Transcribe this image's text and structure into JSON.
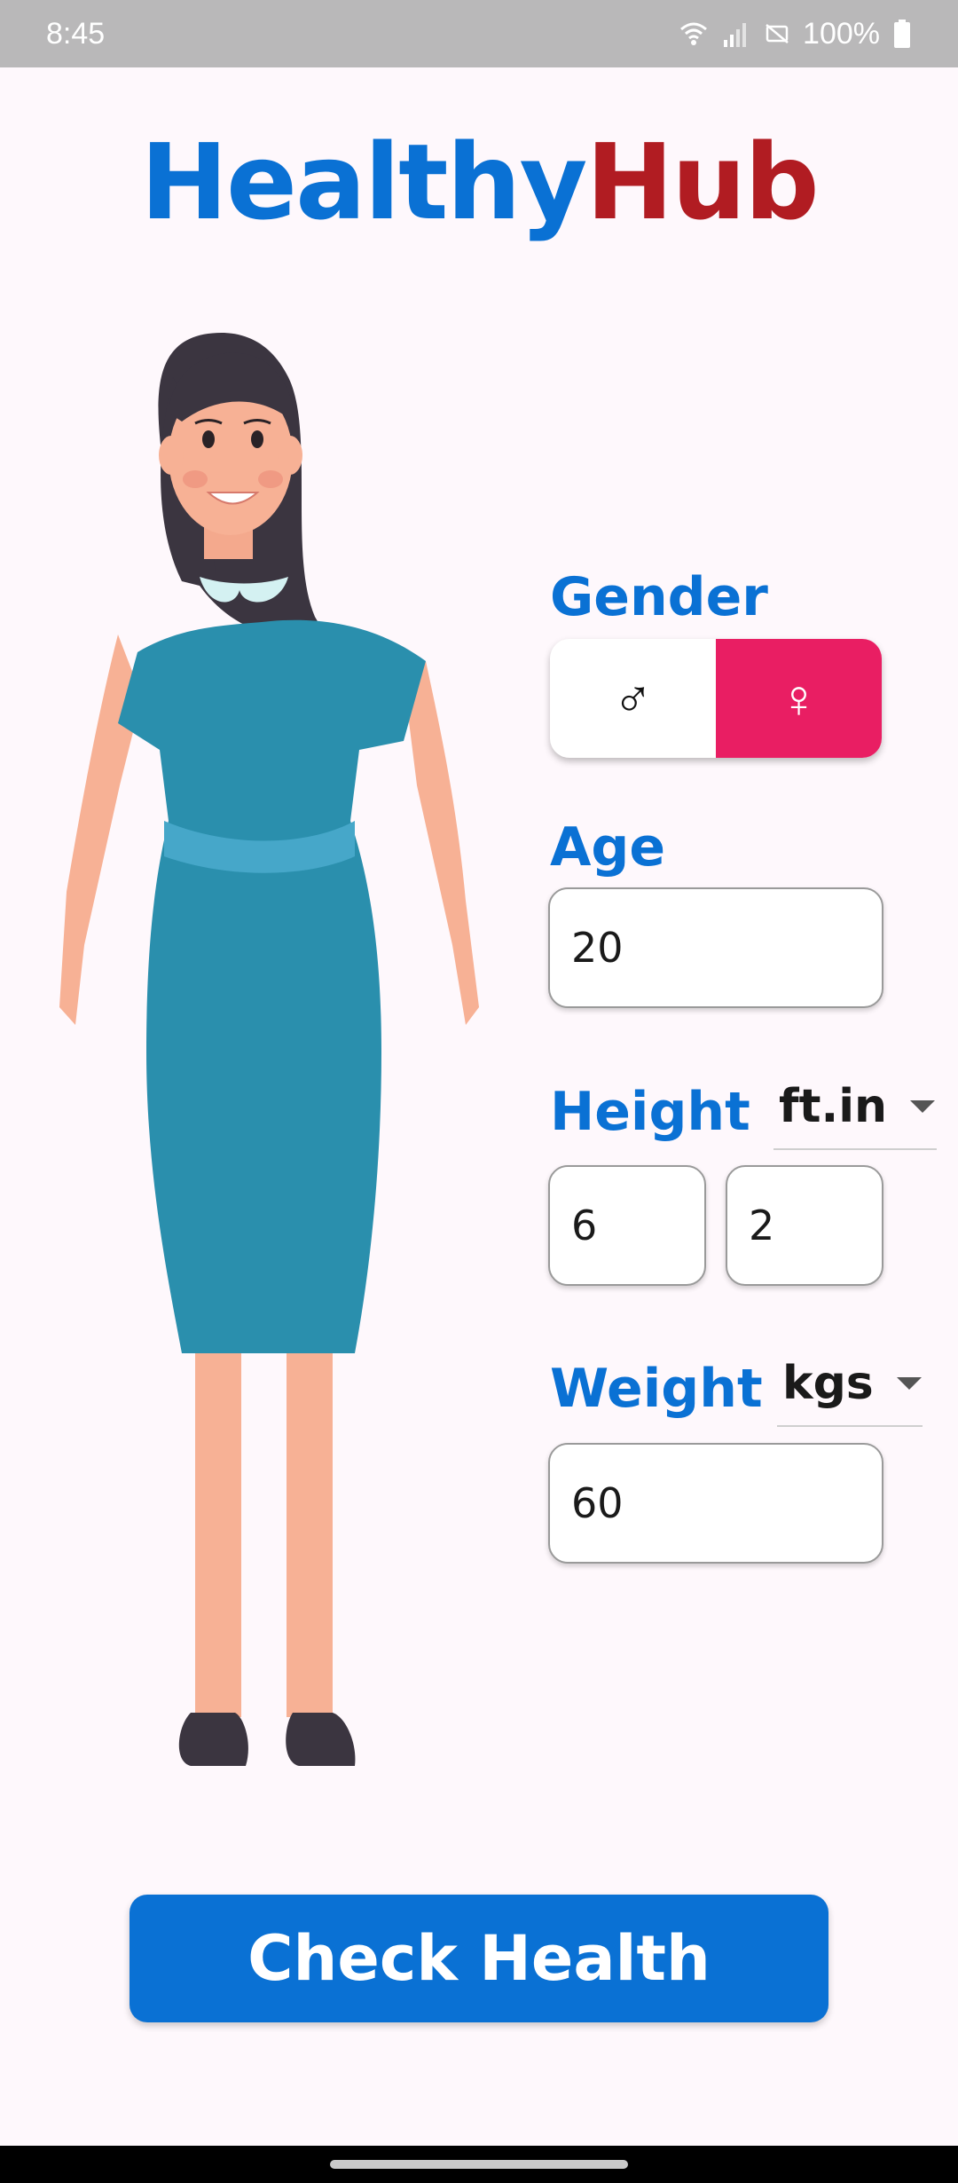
{
  "status_bar": {
    "time": "8:45",
    "battery": "100%",
    "icons": [
      "wifi-icon",
      "signal-icon",
      "no-sim-icon",
      "battery-icon"
    ]
  },
  "app": {
    "title_part_a": "Healthy",
    "title_part_b": "Hub",
    "colors": {
      "primary": "#0a71d4",
      "accent_red": "#b11c22",
      "female": "#e91e63"
    }
  },
  "form": {
    "gender_label": "Gender",
    "gender_options": [
      {
        "name": "male",
        "symbol": "♂",
        "selected": false
      },
      {
        "name": "female",
        "symbol": "♀",
        "selected": true
      }
    ],
    "age_label": "Age",
    "age_value": "20",
    "height_label": "Height",
    "height_unit": "ft.in",
    "height_feet": "6",
    "height_inches": "2",
    "weight_label": "Weight",
    "weight_unit": "kgs",
    "weight_value": "60"
  },
  "actions": {
    "check_label": "Check Health"
  }
}
